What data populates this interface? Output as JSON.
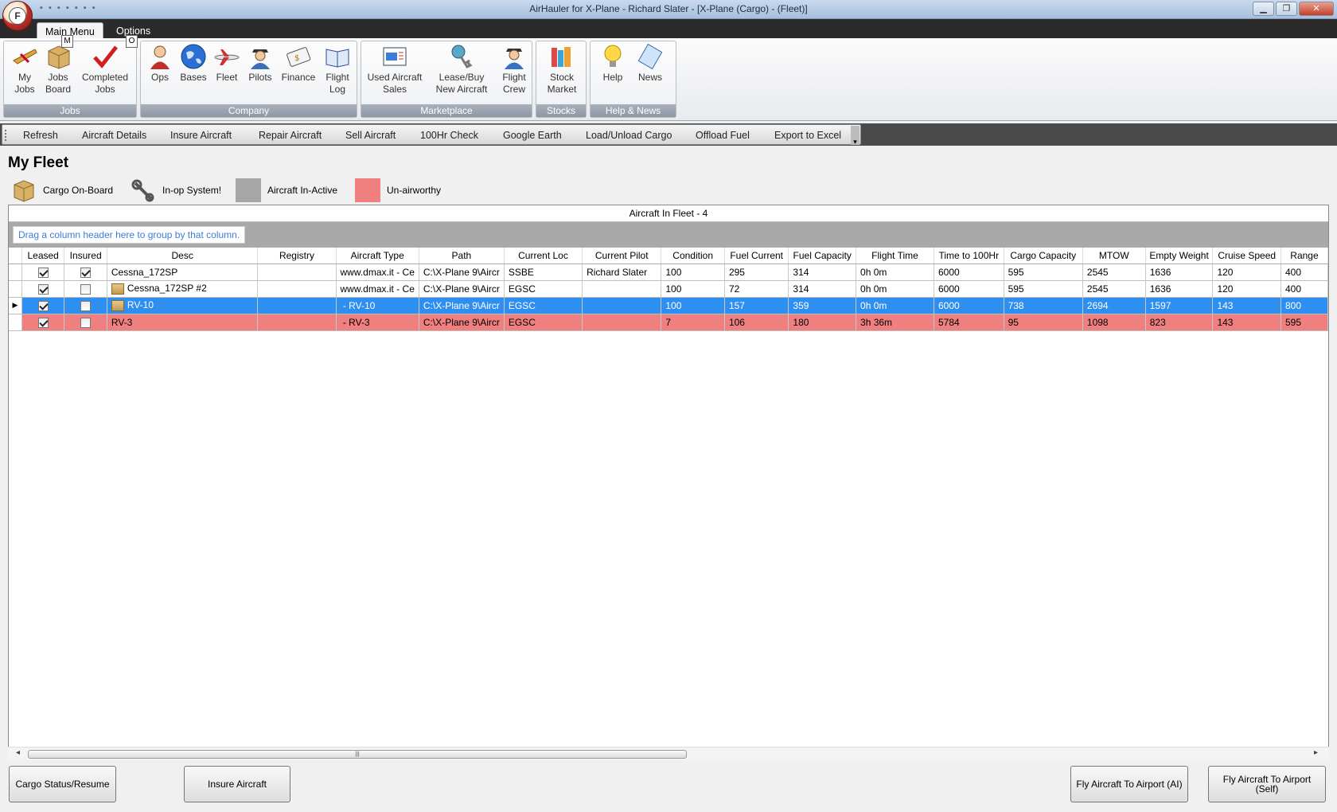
{
  "window": {
    "title": "AirHauler for X-Plane - Richard Slater - [X-Plane (Cargo) - (Fleet)]",
    "app_button_letter": "F"
  },
  "tabs": [
    {
      "label": "Main Menu",
      "keytip": "M"
    },
    {
      "label": "Options",
      "keytip": "O"
    }
  ],
  "ribbon": {
    "groups": [
      {
        "title": "Jobs",
        "buttons": [
          {
            "label": "My Jobs",
            "icon": "airplane-pencil-icon"
          },
          {
            "label": "Jobs Board",
            "icon": "cargo-box-icon"
          },
          {
            "label": "Completed Jobs",
            "icon": "checkmark-icon"
          }
        ]
      },
      {
        "title": "Company",
        "buttons": [
          {
            "label": "Ops",
            "icon": "ops-person-icon"
          },
          {
            "label": "Bases",
            "icon": "globe-icon"
          },
          {
            "label": "Fleet",
            "icon": "airliner-icon"
          },
          {
            "label": "Pilots",
            "icon": "pilot-icon"
          },
          {
            "label": "Finance",
            "icon": "finance-card-icon"
          },
          {
            "label": "Flight Log",
            "icon": "logbook-icon"
          }
        ]
      },
      {
        "title": "Marketplace",
        "buttons": [
          {
            "label": "Used Aircraft Sales",
            "icon": "sales-brochure-icon"
          },
          {
            "label": "Lease/Buy New Aircraft",
            "icon": "keys-icon"
          },
          {
            "label": "Flight Crew",
            "icon": "crew-icon"
          }
        ]
      },
      {
        "title": "Stocks",
        "buttons": [
          {
            "label": "Stock Market",
            "icon": "stock-books-icon"
          }
        ]
      },
      {
        "title": "Help & News",
        "buttons": [
          {
            "label": "Help",
            "icon": "lightbulb-icon"
          },
          {
            "label": "News",
            "icon": "news-icon"
          }
        ]
      }
    ]
  },
  "commands": [
    "Refresh",
    "Aircraft Details",
    "Insure Aircraft",
    "Repair Aircraft",
    "Sell Aircraft",
    "100Hr Check",
    "Google Earth",
    "Load/Unload Cargo",
    "Offload Fuel",
    "Export to Excel"
  ],
  "page_title": "My Fleet",
  "legend": [
    {
      "label": "Cargo On-Board",
      "icon": "cargo-box-icon"
    },
    {
      "label": "In-op System!",
      "icon": "wrench-icon"
    },
    {
      "label": "Aircraft In-Active",
      "color": "#a6a6a6"
    },
    {
      "label": "Un-airworthy",
      "color": "#f08080"
    }
  ],
  "grid": {
    "caption": "Aircraft In Fleet - 4",
    "group_hint": "Drag a column header here to group by that column.",
    "columns": [
      "Leased",
      "Insured",
      "Desc",
      "Registry",
      "Aircraft Type",
      "Path",
      "Current Loc",
      "Current Pilot",
      "Condition",
      "Fuel Current",
      "Fuel Capacity",
      "Flight Time",
      "Time to 100Hr",
      "Cargo Capacity",
      "MTOW",
      "Empty Weight",
      "Cruise Speed",
      "Range"
    ],
    "rows": [
      {
        "leased": true,
        "insured": true,
        "cargo": false,
        "state": "normal",
        "cells": [
          "Cessna_172SP",
          "",
          "www.dmax.it - Ce",
          "C:\\X-Plane 9\\Aircr",
          "SSBE",
          "Richard Slater",
          "100",
          "295",
          "314",
          "0h 0m",
          "6000",
          "595",
          "2545",
          "1636",
          "120",
          "400"
        ]
      },
      {
        "leased": true,
        "insured": false,
        "cargo": true,
        "state": "normal",
        "cells": [
          "Cessna_172SP #2",
          "",
          "www.dmax.it - Ce",
          "C:\\X-Plane 9\\Aircr",
          "EGSC",
          "",
          "100",
          "72",
          "314",
          "0h 0m",
          "6000",
          "595",
          "2545",
          "1636",
          "120",
          "400"
        ]
      },
      {
        "leased": true,
        "insured": false,
        "cargo": true,
        "state": "selected",
        "cells": [
          "RV-10",
          "",
          " - RV-10",
          "C:\\X-Plane 9\\Aircr",
          "EGSC",
          "",
          "100",
          "157",
          "359",
          "0h 0m",
          "6000",
          "738",
          "2694",
          "1597",
          "143",
          "800"
        ]
      },
      {
        "leased": true,
        "insured": false,
        "cargo": false,
        "state": "unairworthy",
        "cells": [
          "RV-3",
          "",
          " - RV-3",
          "C:\\X-Plane 9\\Aircr",
          "EGSC",
          "",
          "7",
          "106",
          "180",
          "3h 36m",
          "5784",
          "95",
          "1098",
          "823",
          "143",
          "595"
        ]
      }
    ]
  },
  "buttons": {
    "cargo_status": "Cargo Status/Resume",
    "insure": "Insure Aircraft",
    "fly_ai": "Fly Aircraft To Airport (AI)",
    "fly_self": "Fly Aircraft To Airport (Self)"
  }
}
